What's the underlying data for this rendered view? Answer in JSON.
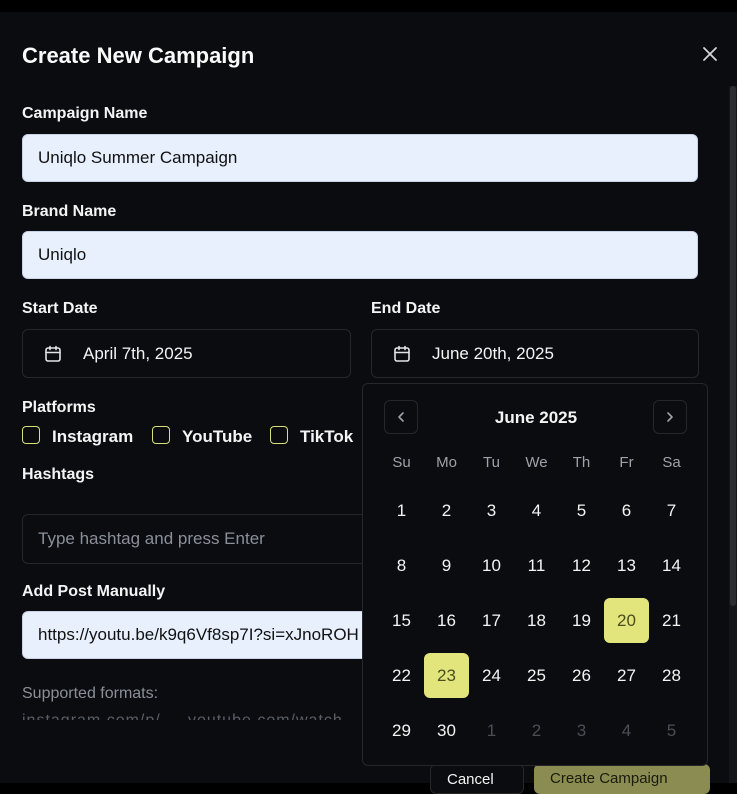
{
  "dialog": {
    "title": "Create New Campaign"
  },
  "form": {
    "campaign_name_label": "Campaign Name",
    "campaign_name_value": "Uniqlo Summer Campaign",
    "brand_name_label": "Brand Name",
    "brand_name_value": "Uniqlo",
    "start_date_label": "Start Date",
    "start_date_value": "April 7th, 2025",
    "end_date_label": "End Date",
    "end_date_value": "June 20th, 2025",
    "platforms_label": "Platforms",
    "platforms": [
      {
        "label": "Instagram",
        "checked": false
      },
      {
        "label": "YouTube",
        "checked": false
      },
      {
        "label": "TikTok",
        "checked": false
      }
    ],
    "hashtags_label": "Hashtags",
    "hashtags_placeholder": "Type hashtag and press Enter",
    "add_post_label": "Add Post Manually",
    "add_post_value": "https://youtu.be/k9q6Vf8sp7I?si=xJnoROH",
    "supported_formats_label": "Supported formats:",
    "supported_formats_hint": "instagram.com/p/ ... youtube.com/watch"
  },
  "footer": {
    "cancel_label": "Cancel",
    "submit_label": "Create Campaign"
  },
  "calendar": {
    "month_label": "June 2025",
    "weekdays": [
      "Su",
      "Mo",
      "Tu",
      "We",
      "Th",
      "Fr",
      "Sa"
    ],
    "weeks": [
      [
        "1",
        "2",
        "3",
        "4",
        "5",
        "6",
        "7"
      ],
      [
        "8",
        "9",
        "10",
        "11",
        "12",
        "13",
        "14"
      ],
      [
        "15",
        "16",
        "17",
        "18",
        "19",
        "20",
        "21"
      ],
      [
        "22",
        "23",
        "24",
        "25",
        "26",
        "27",
        "28"
      ],
      [
        "29",
        "30",
        "1",
        "2",
        "3",
        "4",
        "5"
      ]
    ],
    "outside_days": [
      [
        4,
        2
      ],
      [
        4,
        3
      ],
      [
        4,
        4
      ],
      [
        4,
        5
      ],
      [
        4,
        6
      ]
    ],
    "selected_days": [
      [
        2,
        5
      ],
      [
        3,
        1
      ]
    ],
    "accent_color": "#e1e57c"
  },
  "icons": {
    "close": "close-icon",
    "calendar": "calendar-icon",
    "prev": "chevron-left-icon",
    "next": "chevron-right-icon"
  }
}
